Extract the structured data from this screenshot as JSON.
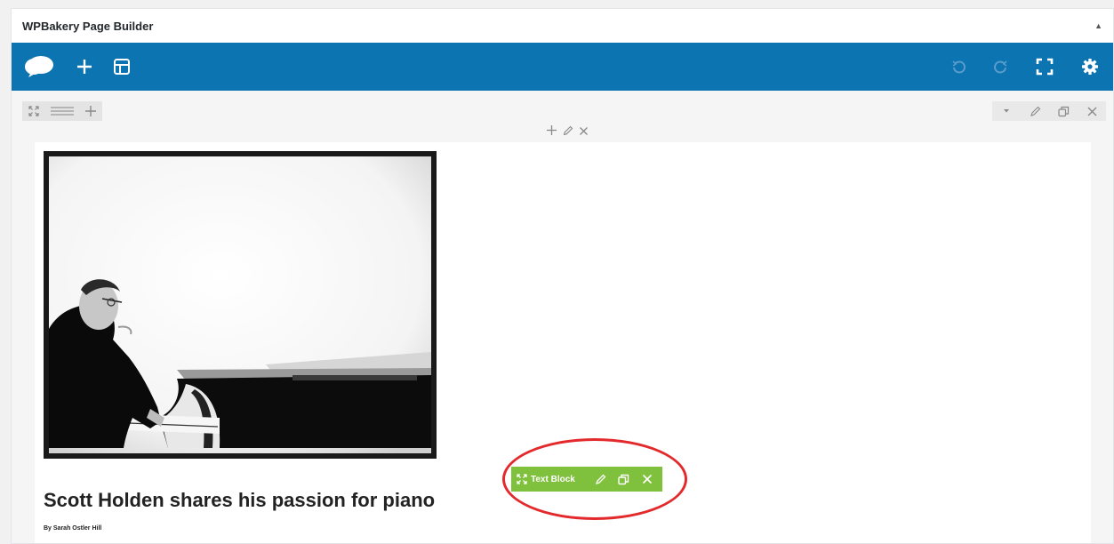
{
  "panel": {
    "title": "WPBakery Page Builder",
    "collapse_icon": "triangle-up-icon"
  },
  "toolbar": {
    "background": "#0b74b1",
    "left_buttons": [
      "logo-icon",
      "add-element-icon",
      "templates-icon"
    ],
    "right_buttons": [
      "undo-icon",
      "redo-icon",
      "fullscreen-icon",
      "settings-icon"
    ]
  },
  "row_controls": {
    "left": [
      "expand-icon",
      "drag-handle-icon",
      "add-column-icon"
    ],
    "right": [
      "toggle-icon",
      "edit-icon",
      "clone-icon",
      "delete-icon"
    ]
  },
  "column_controls": [
    "add-icon",
    "edit-icon",
    "delete-icon"
  ],
  "content": {
    "image_alt": "Black and white photo of a man playing a grand piano",
    "article_title": "Scott Holden shares his passion for piano",
    "byline": "By Sarah Ostler Hill"
  },
  "text_block": {
    "label": "Text Block",
    "color": "#7fc03c",
    "highlight_color": "#e3292b"
  }
}
